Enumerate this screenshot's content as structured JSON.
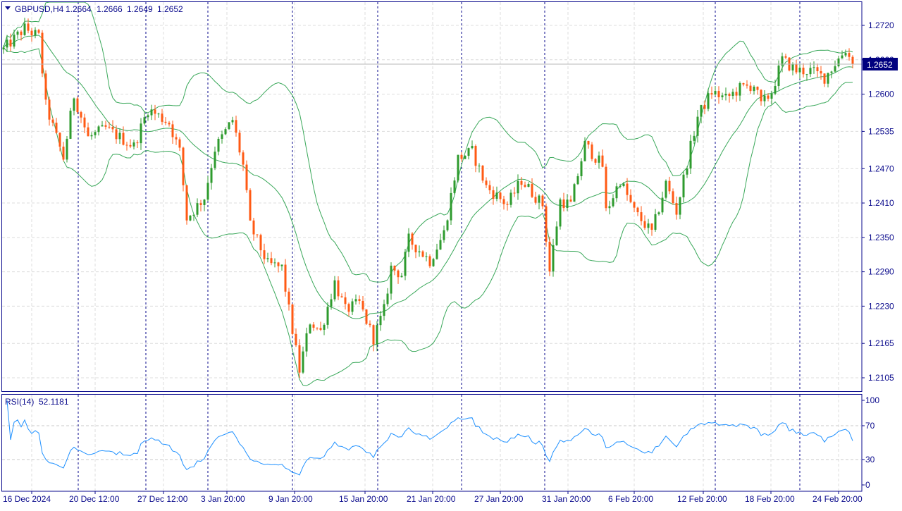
{
  "header": {
    "symbol": "GBPUSD,H4",
    "open": "1.2664",
    "high": "1.2666",
    "low": "1.2649",
    "close": "1.2652"
  },
  "current_price_label": "1.2652",
  "rsi_header": {
    "label": "RSI(14)",
    "value": "52.1181"
  },
  "colors": {
    "bull": "#2e9b2e",
    "bear": "#ff5a14",
    "bands": "#3aa85a",
    "rsi": "#1e90ff",
    "axis": "#0a0a8c",
    "price_box": "#00007f"
  },
  "chart_data": [
    {
      "type": "candlestick",
      "title": "GBPUSD,H4",
      "price_ticks": [
        "1.2720",
        "1.2660",
        "1.2600",
        "1.2535",
        "1.2470",
        "1.2410",
        "1.2350",
        "1.2290",
        "1.2230",
        "1.2165",
        "1.2105"
      ],
      "ylim": [
        1.21,
        1.274
      ],
      "time_labels": [
        "16 Dec 2024",
        "20 Dec 12:00",
        "27 Dec 12:00",
        "3 Jan 20:00",
        "9 Jan 20:00",
        "15 Jan 20:00",
        "21 Jan 20:00",
        "27 Jan 20:00",
        "31 Jan 20:00",
        "6 Feb 20:00",
        "12 Feb 20:00",
        "18 Feb 20:00",
        "24 Feb 20:00"
      ],
      "bar_count": 242,
      "close_path": [
        [
          0,
          1.2678
        ],
        [
          6,
          1.2715
        ],
        [
          10,
          1.27
        ],
        [
          12,
          1.258
        ],
        [
          17,
          1.2488
        ],
        [
          20,
          1.2598
        ],
        [
          24,
          1.2524
        ],
        [
          29,
          1.254
        ],
        [
          37,
          1.2509
        ],
        [
          41,
          1.2574
        ],
        [
          47,
          1.255
        ],
        [
          50,
          1.25
        ],
        [
          52,
          1.2383
        ],
        [
          57,
          1.242
        ],
        [
          60,
          1.2505
        ],
        [
          65,
          1.2555
        ],
        [
          68,
          1.2475
        ],
        [
          70,
          1.2371
        ],
        [
          75,
          1.2303
        ],
        [
          79,
          1.2297
        ],
        [
          81,
          1.2223
        ],
        [
          84,
          1.2118
        ],
        [
          87,
          1.2204
        ],
        [
          90,
          1.2186
        ],
        [
          94,
          1.2272
        ],
        [
          97,
          1.2223
        ],
        [
          101,
          1.2235
        ],
        [
          105,
          1.2174
        ],
        [
          108,
          1.2223
        ],
        [
          110,
          1.2297
        ],
        [
          113,
          1.2285
        ],
        [
          115,
          1.2346
        ],
        [
          121,
          1.2309
        ],
        [
          125,
          1.2358
        ],
        [
          129,
          1.2488
        ],
        [
          133,
          1.25
        ],
        [
          137,
          1.2438
        ],
        [
          143,
          1.2407
        ],
        [
          147,
          1.245
        ],
        [
          153,
          1.2407
        ],
        [
          155,
          1.2291
        ],
        [
          158,
          1.2414
        ],
        [
          161,
          1.2407
        ],
        [
          165,
          1.2512
        ],
        [
          170,
          1.2475
        ],
        [
          171,
          1.2395
        ],
        [
          175,
          1.245
        ],
        [
          179,
          1.2395
        ],
        [
          184,
          1.2358
        ],
        [
          188,
          1.2444
        ],
        [
          191,
          1.2395
        ],
        [
          194,
          1.2481
        ],
        [
          197,
          1.2561
        ],
        [
          201,
          1.2604
        ],
        [
          205,
          1.2592
        ],
        [
          209,
          1.261
        ],
        [
          213,
          1.2616
        ],
        [
          215,
          1.258
        ],
        [
          218,
          1.2604
        ],
        [
          221,
          1.266
        ],
        [
          225,
          1.2641
        ],
        [
          229,
          1.2641
        ],
        [
          233,
          1.2629
        ],
        [
          239,
          1.2678
        ],
        [
          241,
          1.2652
        ]
      ],
      "bollinger": {
        "period": 20,
        "deviations": 2
      },
      "legend": "none"
    },
    {
      "type": "line",
      "title": "RSI(14) 52.1181",
      "y_ticks": [
        "100",
        "70",
        "30",
        "0"
      ],
      "ylim": [
        0,
        100
      ],
      "period": 14,
      "last_value": 52.1181
    }
  ]
}
